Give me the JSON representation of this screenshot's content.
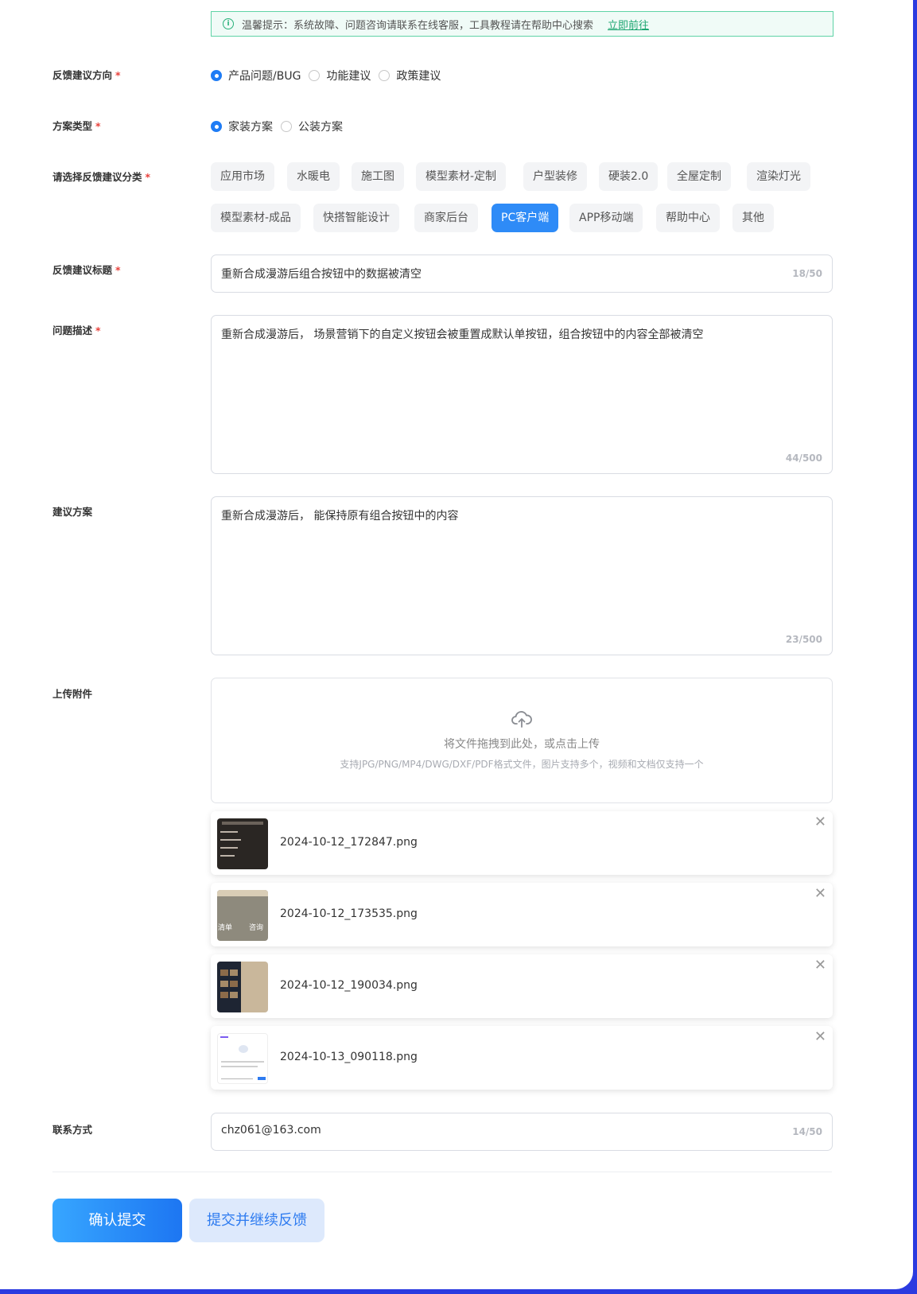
{
  "notice": {
    "icon": "info-icon",
    "text": "温馨提示：系统故障、问题咨询请联系在线客服，工具教程请在帮助中心搜索",
    "link": "立即前往"
  },
  "direction": {
    "label": "反馈建议方向",
    "required_mark": "*",
    "options": [
      "产品问题/BUG",
      "功能建议",
      "政策建议"
    ],
    "selected": "产品问题/BUG"
  },
  "plan_type": {
    "label": "方案类型",
    "required_mark": "*",
    "options": [
      "家装方案",
      "公装方案"
    ],
    "selected": "家装方案"
  },
  "category": {
    "label": "请选择反馈建议分类",
    "required_mark": "*",
    "row1": [
      "应用市场",
      "水暖电",
      "施工图",
      "模型素材-定制",
      "户型装修",
      "硬装2.0",
      "全屋定制",
      "渲染灯光"
    ],
    "row2": [
      "模型素材-成品",
      "快搭智能设计",
      "商家后台",
      "PC客户端",
      "APP移动端",
      "帮助中心",
      "其他"
    ],
    "selected": "PC客户端"
  },
  "title_field": {
    "label": "反馈建议标题",
    "required_mark": "*",
    "value": "重新合成漫游后组合按钮中的数据被清空",
    "count": "18/50"
  },
  "description": {
    "label": "问题描述",
    "required_mark": "*",
    "value": "重新合成漫游后， 场景营销下的自定义按钮会被重置成默认单按钮，组合按钮中的内容全部被清空",
    "count": "44/500"
  },
  "suggestion": {
    "label": "建议方案",
    "value": "重新合成漫游后， 能保持原有组合按钮中的内容",
    "count": "23/500"
  },
  "upload": {
    "label": "上传附件",
    "icon": "upload-cloud-icon",
    "hint": "将文件拖拽到此处，或点击上传",
    "formats": "支持JPG/PNG/MP4/DWG/DXF/PDF格式文件，图片支持多个，视频和文档仅支持一个",
    "files": [
      {
        "name": "2024-10-12_172847.png"
      },
      {
        "name": "2024-10-12_173535.png"
      },
      {
        "name": "2024-10-12_190034.png"
      },
      {
        "name": "2024-10-13_090118.png"
      }
    ],
    "thumb2_text_left": "清单",
    "thumb2_text_right": "咨询"
  },
  "contact": {
    "label": "联系方式",
    "value": "chz061@163.com",
    "count": "14/50"
  },
  "actions": {
    "submit": "确认提交",
    "submit_continue": "提交并继续反馈"
  },
  "colors": {
    "primary": "#1f7cf5",
    "chip_active": "#2e8bf7",
    "required": "#e8413b",
    "notice_border": "#5fd3a6",
    "frame": "#2b3be0"
  }
}
